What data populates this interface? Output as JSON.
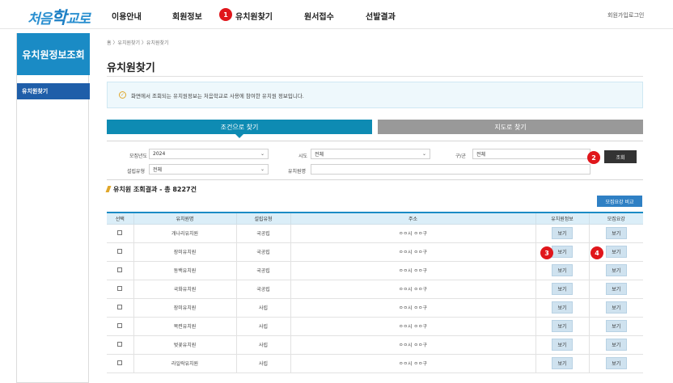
{
  "header": {
    "logo": {
      "part1": "처음",
      "part2": "학",
      "part3": "교로"
    },
    "nav": [
      "이용안내",
      "회원정보",
      "유치원찾기",
      "원서접수",
      "선발결과"
    ],
    "util": {
      "signup": "회원가입",
      "login": "로그인"
    }
  },
  "badges": [
    "1",
    "2",
    "3",
    "4"
  ],
  "sidebar": {
    "title": "유치원정보조회",
    "items": [
      {
        "label": "유치원찾기"
      }
    ]
  },
  "breadcrumb": "홈 〉유치원찾기 〉유치원찾기",
  "page_title": "유치원찾기",
  "notice": "화면에서 조회되는 유치원정보는 처음학교로 사용에 참여한 유치원 정보입니다.",
  "tabs": {
    "condition": "조건으로 찾기",
    "map": "지도로 찾기"
  },
  "search": {
    "year_label": "모집년도",
    "year_value": "2024",
    "sido_label": "시도",
    "sido_value": "전체",
    "gugun_label": "구/군",
    "gugun_value": "전체",
    "type_label": "설립유형",
    "type_value": "전체",
    "name_label": "유치원명",
    "name_value": "",
    "button": "조회"
  },
  "result": {
    "title": "유치원 조회결과 - 총 8227건"
  },
  "compare_button": "모집요강 비교",
  "table": {
    "headers": [
      "선택",
      "유치원명",
      "설립유형",
      "주소",
      "유치원정보",
      "모집요강"
    ],
    "view_label": "보기",
    "rows": [
      {
        "name": "개나리유치원",
        "type": "국공립",
        "address": "ㅇㅇ시 ㅇㅇ구"
      },
      {
        "name": "장미유치원",
        "type": "국공립",
        "address": "ㅇㅇ시 ㅇㅇ구"
      },
      {
        "name": "동백유치원",
        "type": "국공립",
        "address": "ㅇㅇ시 ㅇㅇ구"
      },
      {
        "name": "국화유치원",
        "type": "국공립",
        "address": "ㅇㅇ시 ㅇㅇ구"
      },
      {
        "name": "장미유치원",
        "type": "사립",
        "address": "ㅇㅇ시 ㅇㅇ구"
      },
      {
        "name": "목련유치원",
        "type": "사립",
        "address": "ㅇㅇ시 ㅇㅇ구"
      },
      {
        "name": "벚꽃유치원",
        "type": "사립",
        "address": "ㅇㅇ시 ㅇㅇ구"
      },
      {
        "name": "라일락유치원",
        "type": "사립",
        "address": "ㅇㅇ시 ㅇㅇ구"
      }
    ]
  },
  "colors": {
    "primary": "#1a8bc5",
    "tab_active": "#0e8bb3",
    "tab_inactive": "#999999",
    "badge": "#e0161b",
    "sidebar_active": "#1f5ea9"
  }
}
